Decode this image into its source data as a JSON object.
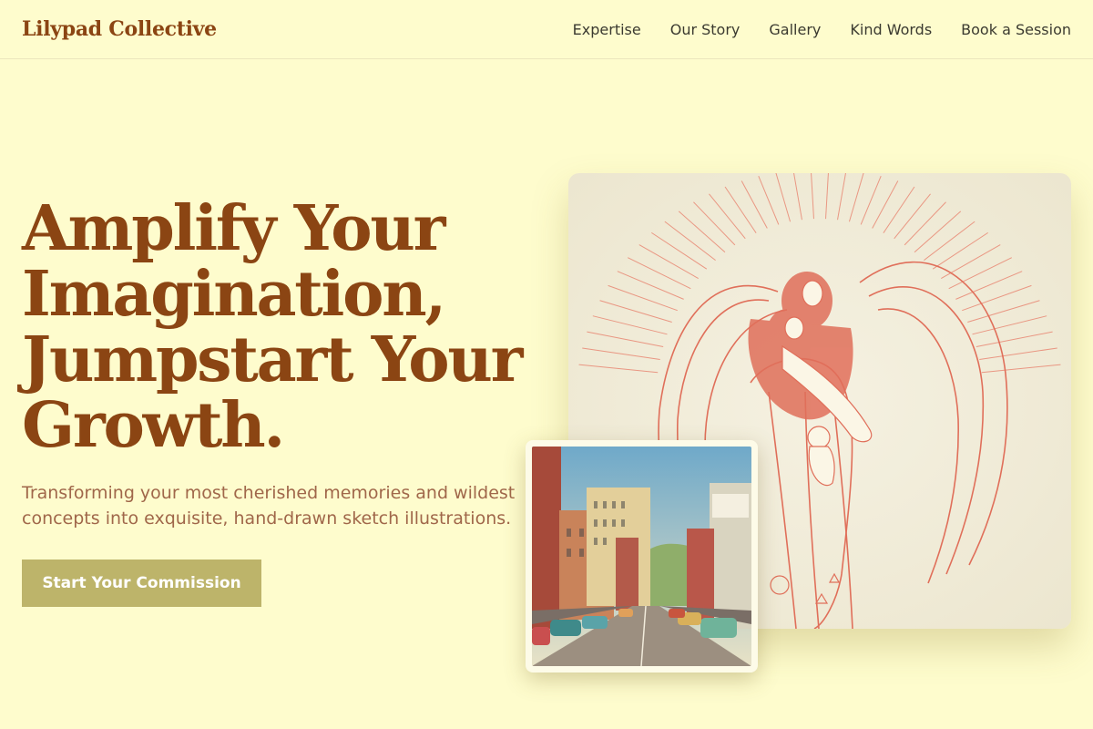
{
  "header": {
    "brand": "Lilypad Collective",
    "nav": [
      "Expertise",
      "Our Story",
      "Gallery",
      "Kind Words",
      "Book a Session"
    ]
  },
  "hero": {
    "title_lines": [
      "Amplify Your",
      "Imagination,",
      "Jumpstart Your",
      "Growth."
    ],
    "subtitle": "Transforming your most cherished memories and wildest concepts into exquisite, hand-drawn sketch illustrations.",
    "cta_label": "Start Your Commission"
  },
  "images": {
    "main": "angel-sketch-illustration",
    "inset": "vintage-street-postcard"
  },
  "colors": {
    "background": "#fefccd",
    "brand": "#8b4513",
    "subtitle": "#a0674a",
    "cta": "#bdb46a",
    "sketch": "#e06f5a"
  }
}
